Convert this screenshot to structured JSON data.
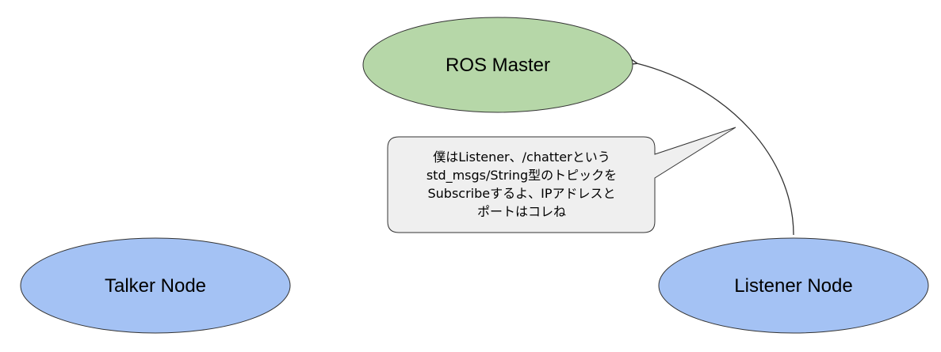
{
  "nodes": {
    "ros_master": {
      "label": "ROS Master",
      "fill": "#b6d7a8",
      "stroke": "#333333"
    },
    "talker": {
      "label": "Talker Node",
      "fill": "#a4c2f4",
      "stroke": "#333333"
    },
    "listener": {
      "label": "Listener Node",
      "fill": "#a4c2f4",
      "stroke": "#333333"
    }
  },
  "callout": {
    "lines": [
      "僕はListener、/chatterという",
      "std_msgs/String型のトピックを",
      "Subscribeするよ、IPアドレスと",
      "ポートはコレね"
    ],
    "fill": "#efefef",
    "stroke": "#333333"
  },
  "connector_color": "#333333"
}
